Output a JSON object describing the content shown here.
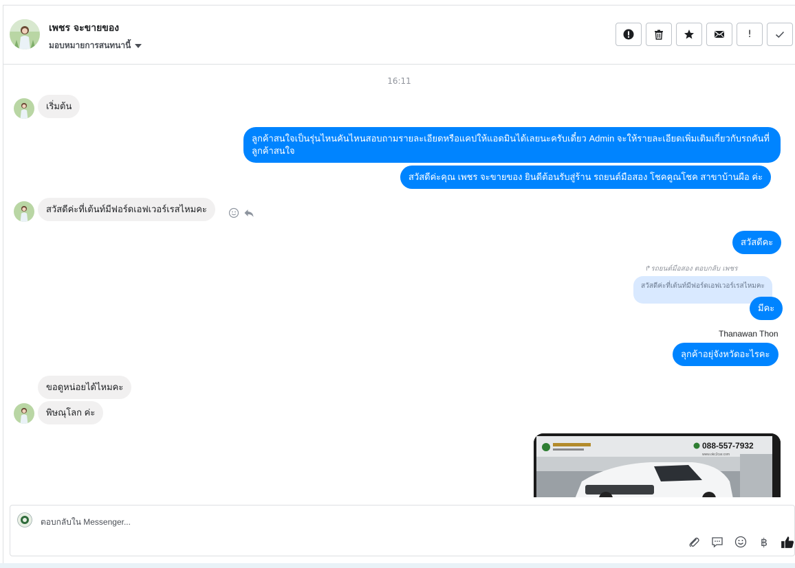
{
  "header": {
    "contact_name": "เพชร จะขายของ",
    "assign_label": "มอบหมายการสนทนานี้"
  },
  "toolbar": {
    "icons": [
      "alert-icon",
      "trash-icon",
      "star-icon",
      "mail-icon",
      "exclamation-icon",
      "check-icon"
    ],
    "exclamation_glyph": "!"
  },
  "conversation": {
    "timestamp": "16:11",
    "messages": [
      {
        "direction": "in",
        "text": "เริ่มต้น"
      },
      {
        "direction": "out",
        "text": "ลูกค้าสนใจเป็นรุ่นไหนคันไหนสอบถามรายละเอียดหรือแคปให้แอดมินได้เลยนะครับเดี๋ยว Admin จะให้รายละเอียดเพิ่มเติมเกี่ยวกับรถคันที่ลูกค้าสนใจ"
      },
      {
        "direction": "out",
        "text": "สวัสดีค่ะคุณ เพชร จะขายของ ยินดีต้อนรับสู่ร้าน รถยนต์มือสอง โชคคูณโชค สาขาบ้านผือ ค่ะ"
      },
      {
        "direction": "in",
        "text": "สวัสดีค่ะที่เต้นท์มีฟอร์ดเอฟเวอร์เรสไหมคะ"
      },
      {
        "direction": "out",
        "text": "สวัสดีคะ"
      },
      {
        "direction": "out",
        "text": "มีคะ"
      },
      {
        "direction": "out",
        "text": "ลุกค้าอยุ่จังหวัดอะไรคะ"
      },
      {
        "direction": "in",
        "text": "ขอดูหน่อยได้ไหมคะ"
      },
      {
        "direction": "in",
        "text": "พิษณุโลก ค่ะ"
      }
    ],
    "reply_meta": "รถยนต์มือสอง ตอบกลับ เพชร",
    "quoted_text": "สวัสดีค่ะที่เต้นท์มีฟอร์ดเอฟเวอร์เรสไหมคะ",
    "sender_name": "Thanawan Thon",
    "photo": {
      "phone": "088-557-7932",
      "website": "www.okc2car.com"
    }
  },
  "composer": {
    "placeholder": "ตอบกลับใน Messenger...",
    "baht_glyph": "฿",
    "tools": [
      "attach-icon",
      "saved-reply-icon",
      "emoji-icon",
      "baht-icon",
      "thumbs-up-icon"
    ]
  },
  "colors": {
    "outgoing": "#0084ff",
    "incoming": "#f1f0f0",
    "quote": "#d9e9ff"
  }
}
